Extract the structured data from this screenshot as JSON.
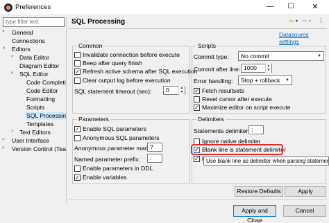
{
  "window": {
    "title": "Preferences"
  },
  "tree": {
    "filter_placeholder": "type filter text",
    "items": [
      "General",
      "Connections",
      "Editors",
      "Data Editor",
      "Diagram Editor",
      "SQL Editor",
      "Code Completi",
      "Code Editor",
      "Formatting",
      "Scripts",
      "SQL Processing",
      "Templates",
      "Text Editors",
      "User Interface",
      "Version Control (Team"
    ]
  },
  "page": {
    "title": "SQL Processing",
    "datasource_link": "Datasource settings"
  },
  "common": {
    "title": "Common",
    "invalidate": "Invalidate connection before execute",
    "beep": "Beep after query finish",
    "refresh": "Refresh active schema after SQL execution",
    "clear_log": "Clear output log before execution",
    "timeout_label": "SQL statement timeout (sec):",
    "timeout_value": "0"
  },
  "scripts": {
    "title": "Scripts",
    "commit_type_label": "Commit type:",
    "commit_type_value": "No commit",
    "commit_after_label": "Commit after line:",
    "commit_after_value": "1000",
    "error_label": "Error handling:",
    "error_value": "Stop + rollback",
    "fetch": "Fetch resultsets",
    "reset_cursor": "Reset cursor after execute",
    "maximize": "Maximize editor on script execute"
  },
  "parameters": {
    "title": "Parameters",
    "enable_sql": "Enable SQL parameters",
    "anon_sql": "Anonymous SQL parameters",
    "anon_mark_label": "Anonymous parameter mark:",
    "anon_mark_value": "?",
    "named_prefix_label": "Named parameter prefix:",
    "named_prefix_value": ":",
    "enable_ddl": "Enable parameters in DDL",
    "enable_vars": "Enable variables"
  },
  "delimiters": {
    "title": "Delimiters",
    "stmt_label": "Statements delimiter:",
    "stmt_value": ";",
    "ignore_native": "Ignore native delimiter",
    "blank_line": "Blank line is statement delimiter",
    "hidden_r": "R",
    "tooltip": "Use blank line as delimiter when parsing statements"
  },
  "buttons": {
    "restore": "Restore Defaults",
    "apply": "Apply",
    "apply_close": "Apply and Close",
    "cancel": "Cancel"
  },
  "icons": {
    "nav_back": "back-arrow-icon",
    "nav_menu": "view-menu-icon"
  },
  "colors": {
    "highlight": "#e02a2a",
    "link": "#0066cc",
    "selection": "#cce8ff"
  }
}
